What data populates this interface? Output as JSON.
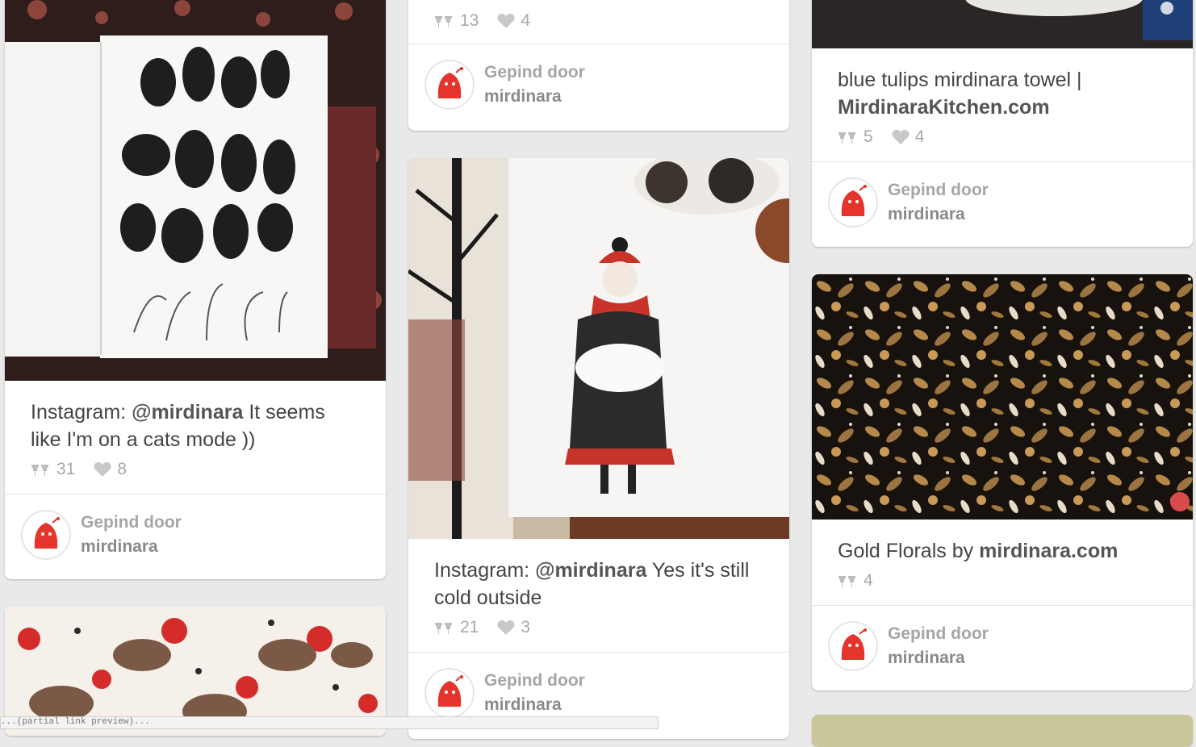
{
  "pins": [
    {
      "id": "cats",
      "desc_prefix": "Instagram: ",
      "desc_bold": "@mirdinara",
      "desc_suffix": " It seems like I'm on a cats mode ))",
      "repins": "31",
      "likes": "8",
      "pinned_label": "Gepind door",
      "pinner": "mirdinara"
    },
    {
      "id": "top-middle",
      "repins": "13",
      "likes": "4",
      "pinned_label": "Gepind door",
      "pinner": "mirdinara"
    },
    {
      "id": "cold",
      "desc_prefix": "Instagram: ",
      "desc_bold": "@mirdinara",
      "desc_suffix": " Yes it's still cold outside",
      "repins": "21",
      "likes": "3",
      "pinned_label": "Gepind door",
      "pinner": "mirdinara"
    },
    {
      "id": "towel",
      "desc_prefix": "blue tulips mirdinara towel | ",
      "desc_bold": "MirdinaraKitchen.com",
      "desc_suffix": "",
      "repins": "5",
      "likes": "4",
      "pinned_label": "Gepind door",
      "pinner": "mirdinara"
    },
    {
      "id": "gold",
      "desc_prefix": "Gold Florals by ",
      "desc_bold": "mirdinara.com",
      "desc_suffix": "",
      "repins": "4",
      "pinned_label": "Gepind door",
      "pinner": "mirdinara"
    }
  ],
  "status_url": "...(partial link preview)..."
}
